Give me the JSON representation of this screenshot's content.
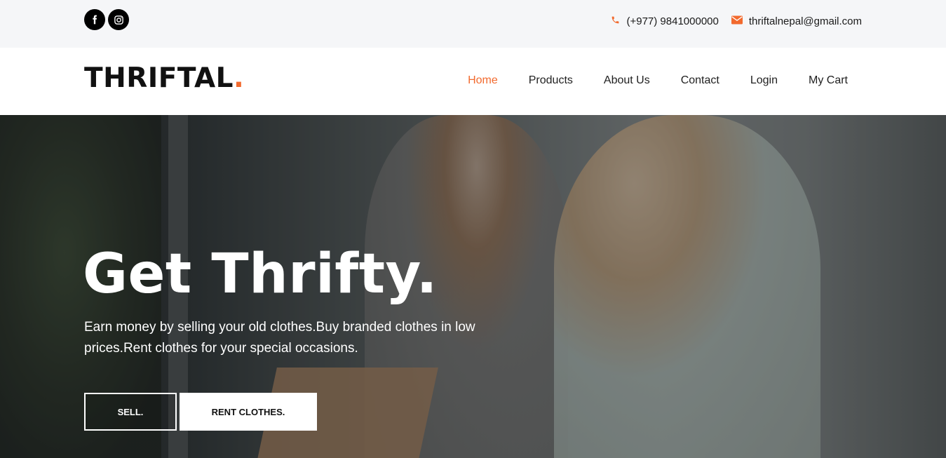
{
  "topbar": {
    "social": [
      {
        "icon": "facebook-icon"
      },
      {
        "icon": "instagram-icon"
      }
    ],
    "phone": "(+977) 9841000000",
    "email": "thriftalnepal@gmail.com",
    "accent_color": "#f26a2e"
  },
  "navbar": {
    "logo_text": "THRIFTAL",
    "logo_dot": ".",
    "menu": [
      {
        "label": "Home",
        "active": true
      },
      {
        "label": "Products"
      },
      {
        "label": "About Us"
      },
      {
        "label": "Contact"
      },
      {
        "label": "Login"
      },
      {
        "label": "My Cart"
      }
    ]
  },
  "hero": {
    "title": "Get Thrifty.",
    "subtitle": "Earn money by selling your old clothes.Buy branded clothes in low prices.Rent clothes for your special occasions.",
    "buttons": {
      "sell_label": "SELL.",
      "rent_label": "RENT CLOTHES."
    }
  }
}
